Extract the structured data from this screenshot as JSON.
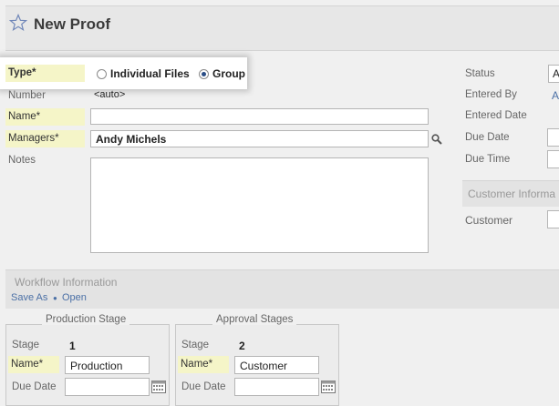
{
  "header": {
    "title": "New Proof",
    "star_icon": "star-icon"
  },
  "type": {
    "label": "Type*",
    "options": [
      {
        "label": "Individual Files",
        "selected": false
      },
      {
        "label": "Group",
        "selected": true
      }
    ]
  },
  "number": {
    "label": "Number",
    "value": "<auto>"
  },
  "name": {
    "label": "Name*",
    "value": ""
  },
  "managers": {
    "label": "Managers*",
    "value": "Andy Michels",
    "search_icon": "search-icon"
  },
  "notes": {
    "label": "Notes",
    "value": ""
  },
  "right": {
    "status": {
      "label": "Status",
      "value": "A"
    },
    "entered_by": {
      "label": "Entered By",
      "value": "A"
    },
    "entered_date": {
      "label": "Entered Date"
    },
    "due_date": {
      "label": "Due Date"
    },
    "due_time": {
      "label": "Due Time"
    },
    "customer_section": {
      "label": "Customer Informa"
    },
    "customer": {
      "label": "Customer"
    }
  },
  "workflow": {
    "title": "Workflow Information",
    "save_as": "Save As",
    "separator": "●",
    "open": "Open",
    "stages": [
      {
        "legend": "Production Stage",
        "stage_label": "Stage",
        "stage_value": "1",
        "name_label": "Name*",
        "name_value": "Production",
        "due_label": "Due Date"
      },
      {
        "legend": "Approval Stages",
        "stage_label": "Stage",
        "stage_value": "2",
        "name_label": "Name*",
        "name_value": "Customer",
        "due_label": "Due Date"
      }
    ]
  },
  "colors": {
    "required_bg": "#f5f5c8",
    "link": "#4b70a6",
    "radio_selected": "#2a4d86"
  }
}
